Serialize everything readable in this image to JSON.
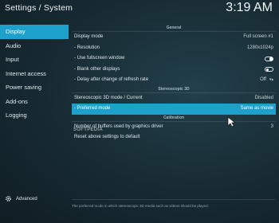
{
  "header": {
    "title": "Settings / System",
    "clock": "3:19 AM"
  },
  "sidebar": {
    "items": [
      {
        "label": "Display",
        "active": true
      },
      {
        "label": "Audio",
        "active": false
      },
      {
        "label": "Input",
        "active": false
      },
      {
        "label": "Internet access",
        "active": false
      },
      {
        "label": "Power saving",
        "active": false
      },
      {
        "label": "Add-ons",
        "active": false
      },
      {
        "label": "Logging",
        "active": false
      }
    ],
    "advanced_label": "Advanced",
    "advanced_icon": "gear-icon"
  },
  "main": {
    "general": {
      "header": "General",
      "display_mode": {
        "label": "Display mode",
        "value": "Full screen #1"
      },
      "resolution": {
        "label": "- Resolution",
        "value": "1280x1024p"
      },
      "fullscreen_window": {
        "label": "- Use fullscreen window",
        "state": "on"
      },
      "blank_displays": {
        "label": "- Blank other displays",
        "state": "off"
      },
      "refresh_delay": {
        "label": "- Delay after change of refresh rate",
        "value": "Off"
      }
    },
    "stereoscopic": {
      "header": "Stereoscopic 3D",
      "mode": {
        "label": "Stereoscopic 3D mode / Current",
        "value": "Disabled"
      },
      "preferred": {
        "label": "- Preferred mode",
        "value": "Same as movie"
      }
    },
    "calibration": {
      "header": "Calibration",
      "buffers": {
        "label": "Number of buffers used by graphics driver",
        "value": "3"
      },
      "reset": {
        "label": "Reset above settings to default"
      }
    }
  },
  "footer_text": "The preferred mode in which stereoscopic 3D media such as videos should be played.",
  "watermark": "SOFTPEDIA",
  "colors": {
    "accent": "#1da1cc",
    "background": "#1a2b33"
  }
}
